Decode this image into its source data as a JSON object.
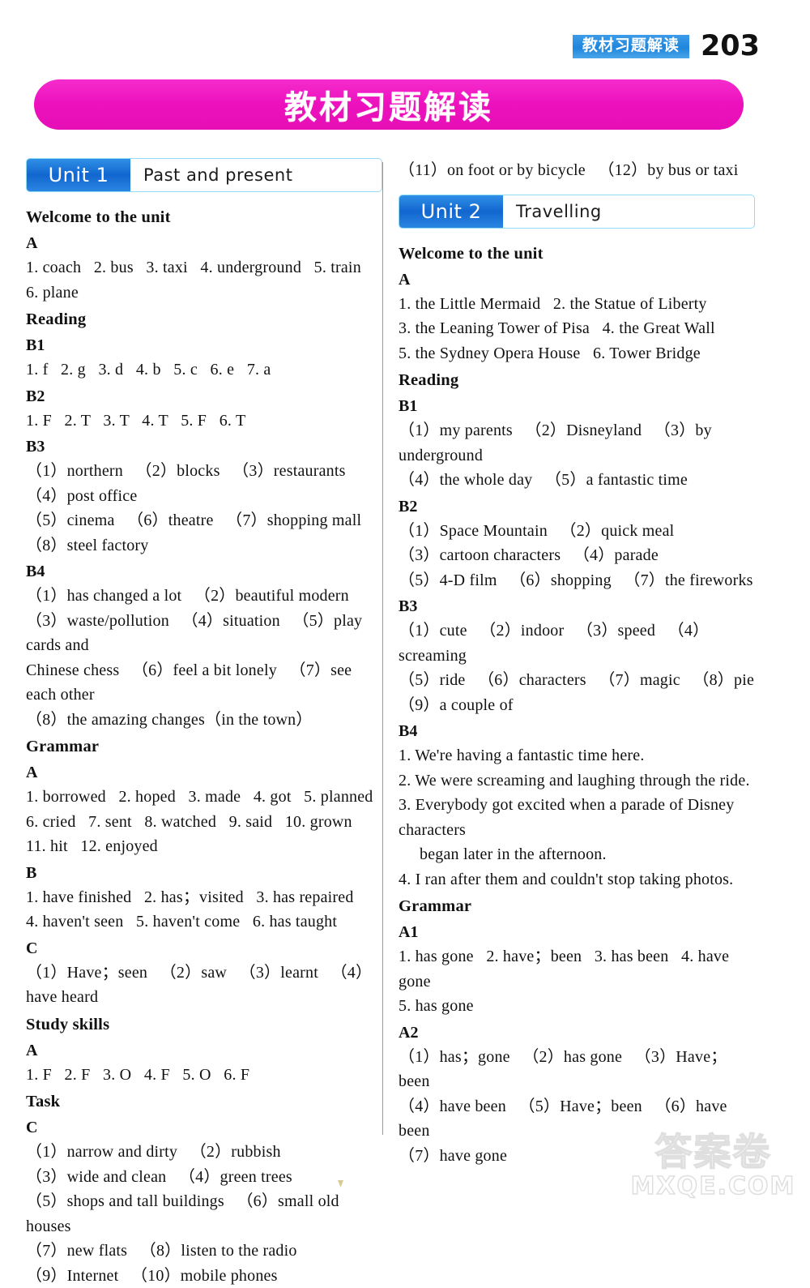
{
  "runhead": {
    "tag": "教材习题解读",
    "page_number": "203"
  },
  "banner": {
    "title": "教材习题解读",
    "color": "#ef17c0"
  },
  "accent": {
    "unit_tag_blue": "#1266cf",
    "unit_border_blue": "#8fdcf4",
    "runhead_blue": "#1f86dc"
  },
  "left_column": {
    "unit": {
      "tag": "Unit 1",
      "title": "Past and present"
    },
    "blocks": [
      {
        "type": "sec",
        "text": "Welcome to the unit"
      },
      {
        "type": "sub",
        "text": "A"
      },
      {
        "type": "ans",
        "text": "1. coach   2. bus   3. taxi   4. underground   5. train"
      },
      {
        "type": "ans",
        "text": "6. plane"
      },
      {
        "type": "sec",
        "text": "Reading"
      },
      {
        "type": "sub",
        "text": "B1"
      },
      {
        "type": "ans",
        "text": "1. f   2. g   3. d   4. b   5. c   6. e   7. a"
      },
      {
        "type": "sub",
        "text": "B2"
      },
      {
        "type": "ans",
        "text": "1. F   2. T   3. T   4. T   5. F   6. T"
      },
      {
        "type": "sub",
        "text": "B3"
      },
      {
        "type": "ans",
        "text": "（1）northern   （2）blocks   （3）restaurants   （4）post office"
      },
      {
        "type": "ans",
        "text": "（5）cinema   （6）theatre   （7）shopping mall"
      },
      {
        "type": "ans",
        "text": "（8）steel factory"
      },
      {
        "type": "sub",
        "text": "B4"
      },
      {
        "type": "ans",
        "text": "（1）has changed a lot   （2）beautiful modern"
      },
      {
        "type": "ans",
        "text": "（3）waste/pollution   （4）situation   （5）play cards and"
      },
      {
        "type": "ans",
        "text": "Chinese chess   （6）feel a bit lonely   （7）see each other"
      },
      {
        "type": "ans",
        "text": "（8）the amazing changes（in the town）"
      },
      {
        "type": "sec",
        "text": "Grammar"
      },
      {
        "type": "sub",
        "text": "A"
      },
      {
        "type": "ans",
        "text": "1. borrowed   2. hoped   3. made   4. got   5. planned"
      },
      {
        "type": "ans",
        "text": "6. cried   7. sent   8. watched   9. said   10. grown"
      },
      {
        "type": "ans",
        "text": "11. hit   12. enjoyed"
      },
      {
        "type": "sub",
        "text": "B"
      },
      {
        "type": "ans",
        "text": "1. have finished   2. has；visited   3. has repaired"
      },
      {
        "type": "ans",
        "text": "4. haven't seen   5. haven't come   6. has taught"
      },
      {
        "type": "sub",
        "text": "C"
      },
      {
        "type": "ans",
        "text": "（1）Have；seen   （2）saw   （3）learnt   （4）have heard"
      },
      {
        "type": "sec",
        "text": "Study skills"
      },
      {
        "type": "sub",
        "text": "A"
      },
      {
        "type": "ans",
        "text": "1. F   2. F   3. O   4. F   5. O   6. F"
      },
      {
        "type": "sec",
        "text": "Task"
      },
      {
        "type": "sub",
        "text": "C"
      },
      {
        "type": "ans",
        "text": "（1）narrow and dirty   （2）rubbish"
      },
      {
        "type": "ans",
        "text": "（3）wide and clean   （4）green trees"
      },
      {
        "type": "ans",
        "text": "（5）shops and tall buildings   （6）small old houses"
      },
      {
        "type": "ans",
        "text": "（7）new flats   （8）listen to the radio"
      },
      {
        "type": "ans",
        "text": "（9）Internet   （10）mobile phones"
      }
    ]
  },
  "right_column": {
    "lead_line": "（11）on foot or by bicycle   （12）by bus or taxi",
    "unit": {
      "tag": "Unit 2",
      "title": "Travelling"
    },
    "blocks": [
      {
        "type": "sec",
        "text": "Welcome to the unit"
      },
      {
        "type": "sub",
        "text": "A"
      },
      {
        "type": "ans",
        "text": "1. the Little Mermaid   2. the Statue of Liberty"
      },
      {
        "type": "ans",
        "text": "3. the Leaning Tower of Pisa   4. the Great Wall"
      },
      {
        "type": "ans",
        "text": "5. the Sydney Opera House   6. Tower Bridge"
      },
      {
        "type": "sec",
        "text": "Reading"
      },
      {
        "type": "sub",
        "text": "B1"
      },
      {
        "type": "ans",
        "text": "（1）my parents   （2）Disneyland   （3）by underground"
      },
      {
        "type": "ans",
        "text": "（4）the whole day   （5）a fantastic time"
      },
      {
        "type": "sub",
        "text": "B2"
      },
      {
        "type": "ans",
        "text": "（1）Space Mountain   （2）quick meal"
      },
      {
        "type": "ans",
        "text": "（3）cartoon characters   （4）parade"
      },
      {
        "type": "ans",
        "text": "（5）4-D film   （6）shopping   （7）the fireworks"
      },
      {
        "type": "sub",
        "text": "B3"
      },
      {
        "type": "ans",
        "text": "（1）cute   （2）indoor   （3）speed   （4）screaming"
      },
      {
        "type": "ans",
        "text": "（5）ride   （6）characters   （7）magic   （8）pie"
      },
      {
        "type": "ans",
        "text": "（9）a couple of"
      },
      {
        "type": "sub",
        "text": "B4"
      },
      {
        "type": "ans",
        "text": "1. We're having a fantastic time here."
      },
      {
        "type": "ans",
        "text": "2. We were screaming and laughing through the ride."
      },
      {
        "type": "ans",
        "text": "3. Everybody got excited when a parade of Disney characters"
      },
      {
        "type": "ans",
        "indent": true,
        "text": "began later in the afternoon."
      },
      {
        "type": "ans",
        "text": "4. I ran after them and couldn't stop taking photos."
      },
      {
        "type": "sec",
        "text": "Grammar"
      },
      {
        "type": "sub",
        "text": "A1"
      },
      {
        "type": "ans",
        "text": "1. has gone   2. have；been   3. has been   4. have gone"
      },
      {
        "type": "ans",
        "text": "5. has gone"
      },
      {
        "type": "sub",
        "text": "A2"
      },
      {
        "type": "ans",
        "text": "（1）has；gone   （2）has gone   （3）Have；been"
      },
      {
        "type": "ans",
        "text": "（4）have been   （5）Have；been   （6）have been"
      },
      {
        "type": "ans",
        "text": "（7）have gone"
      }
    ]
  },
  "watermark": {
    "chinese": "答案卷",
    "site": "MXQE.COM"
  }
}
